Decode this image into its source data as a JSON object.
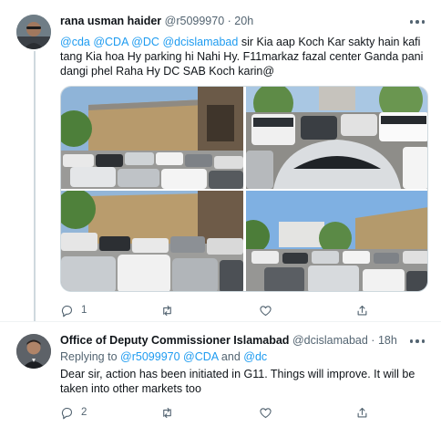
{
  "colors": {
    "link": "#1d9bf0",
    "secondary_text": "#536471",
    "primary_text": "#0f1419",
    "thread_line": "#cfd9de"
  },
  "tweet1": {
    "author_name": "rana usman haider",
    "handle": "@r5099970",
    "separator": "·",
    "time": "20h",
    "mentions": [
      "@cda",
      "@CDA",
      "@DC",
      "@dcislamabad"
    ],
    "text_line1": "sir Kia aap Koch Kar sakty hain  kafi tang",
    "text_rest": "Kia hoa Hy parking hi Nahi Hy. F11markaz fazal center  Ganda pani  dangi phel Raha Hy DC SAB Koch karin@",
    "photos": [
      {
        "icon": "parking-lot-photo",
        "alt": "cars parked in front of building"
      },
      {
        "icon": "parking-lot-photo",
        "alt": "crowded parking between cars"
      },
      {
        "icon": "parking-lot-photo",
        "alt": "cars parked near building and tree"
      },
      {
        "icon": "parking-lot-photo",
        "alt": "crowded parking with buildings and trees"
      }
    ],
    "reply_count": "1",
    "retweet_count": "",
    "like_count": "",
    "icons": [
      "comment-icon",
      "retweet-icon",
      "heart-icon",
      "share-icon",
      "more-icon"
    ]
  },
  "tweet2": {
    "author_name": "Office of Deputy Commissioner Islamabad",
    "handle": "@dcislamabad",
    "separator": "·",
    "time": "18h",
    "replying_prefix": "Replying to",
    "replying_handles": [
      "@r5099970",
      "@CDA",
      "@dc"
    ],
    "replying_and": "and",
    "text": "Dear sir, action has been initiated in G11. Things will improve. It will be taken into other markets too",
    "reply_count": "2",
    "retweet_count": "",
    "like_count": "",
    "icons": [
      "comment-icon",
      "retweet-icon",
      "heart-icon",
      "share-icon",
      "more-icon"
    ]
  }
}
